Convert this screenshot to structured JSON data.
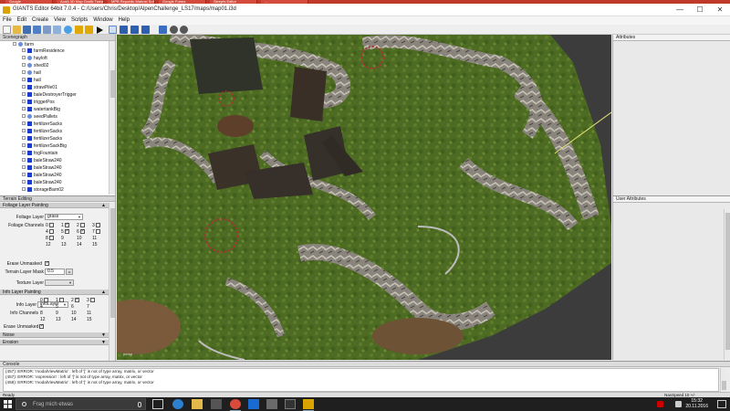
{
  "browser_tabs": [
    "Google",
    "AudA 3D Map Grafik Tweak",
    "MPB Republic Mahnei Sofa",
    "Google Forms",
    "Sleepfs Editor",
    "..."
  ],
  "window": {
    "title": "GIANTS Editor 64bit 7.0.4 - C:/Users/Chris/Desktop/AlpenChallenge_LS17/maps/map01.i3d",
    "minimize": "—",
    "maximize": "☐",
    "close": "✕"
  },
  "menu": [
    "File",
    "Edit",
    "Create",
    "View",
    "Scripts",
    "Window",
    "Help"
  ],
  "toolbar": {
    "icons": [
      "new-icon",
      "open-icon",
      "save-icon",
      "save-as-icon",
      "import-icon",
      "export-icon",
      "refresh-icon",
      "undo-icon",
      "redo-icon",
      "play-icon",
      "select-icon",
      "move-icon",
      "rotate-icon",
      "scale-icon",
      "terrain-icon",
      "settings-icon"
    ]
  },
  "scenegraph": {
    "title": "Scenegraph",
    "root": "farm",
    "items": [
      {
        "label": "farmResidence",
        "type": "mesh"
      },
      {
        "label": "hayloft",
        "type": "tg"
      },
      {
        "label": "shed02",
        "type": "tg"
      },
      {
        "label": "hall",
        "type": "tg"
      },
      {
        "label": "hall",
        "type": "mesh"
      },
      {
        "label": "strawPile01",
        "type": "mesh"
      },
      {
        "label": "baleDestroyerTrigger",
        "type": "mesh"
      },
      {
        "label": "triggerPos",
        "type": "mesh"
      },
      {
        "label": "watertankBig",
        "type": "mesh"
      },
      {
        "label": "seedPallets",
        "type": "tg"
      },
      {
        "label": "fertilizerSacks",
        "type": "mesh"
      },
      {
        "label": "fertilizerSacks",
        "type": "mesh"
      },
      {
        "label": "fertilizerSacks",
        "type": "mesh"
      },
      {
        "label": "fertilizerSackBig",
        "type": "mesh"
      },
      {
        "label": "fogFountain",
        "type": "mesh"
      },
      {
        "label": "baleStraw240",
        "type": "mesh"
      },
      {
        "label": "baleStraw240",
        "type": "mesh"
      },
      {
        "label": "baleStraw240",
        "type": "mesh"
      },
      {
        "label": "baleStraw240",
        "type": "mesh"
      },
      {
        "label": "storageBarn02",
        "type": "mesh"
      },
      {
        "label": "strawPile01",
        "type": "mesh"
      }
    ]
  },
  "terrain_editing": {
    "title": "Terrain Editing",
    "foliage_layer_painting": "Foliage Layer Painting",
    "foliage_layer_label": "Foliage Layer",
    "foliage_layer_value": "grass",
    "foliage_channels_label": "Foliage Channels",
    "foliage_channels": [
      {
        "n": "0",
        "checked": false
      },
      {
        "n": "1",
        "checked": true
      },
      {
        "n": "2",
        "checked": false
      },
      {
        "n": "3",
        "checked": false
      },
      {
        "n": "4",
        "checked": false
      },
      {
        "n": "5",
        "checked": true
      },
      {
        "n": "6",
        "checked": true
      },
      {
        "n": "7",
        "checked": false
      },
      {
        "n": "8",
        "checked": false
      },
      {
        "n": "9",
        "checked": null
      },
      {
        "n": "10",
        "checked": null
      },
      {
        "n": "11",
        "checked": null
      },
      {
        "n": "12",
        "checked": null
      },
      {
        "n": "13",
        "checked": null
      },
      {
        "n": "14",
        "checked": null
      },
      {
        "n": "15",
        "checked": null
      }
    ],
    "erase_unmasked_label": "Erase Unmasked",
    "terrain_layer_mask_label": "Terrain Layer Mask",
    "terrain_layer_mask_value": "0.5",
    "mask_button": "••",
    "texture_layer_label": "Texture Layer",
    "texture_layer_value": "",
    "info_layer_painting": "Info Layer Painting",
    "info_layer_label": "Info Layer",
    "info_layer_value": "infoLayer",
    "info_channels_label": "Info Channels",
    "info_channels": [
      {
        "n": "0",
        "checked": false
      },
      {
        "n": "1",
        "checked": false
      },
      {
        "n": "2",
        "checked": true
      },
      {
        "n": "3",
        "checked": false
      },
      {
        "n": "4",
        "checked": null
      },
      {
        "n": "5",
        "checked": null
      },
      {
        "n": "6",
        "checked": null
      },
      {
        "n": "7",
        "checked": null
      },
      {
        "n": "8",
        "checked": null
      },
      {
        "n": "9",
        "checked": null
      },
      {
        "n": "10",
        "checked": null
      },
      {
        "n": "11",
        "checked": null
      },
      {
        "n": "12",
        "checked": null
      },
      {
        "n": "13",
        "checked": null
      },
      {
        "n": "14",
        "checked": null
      },
      {
        "n": "15",
        "checked": null
      }
    ],
    "erase_unmasked_info_label": "Erase Unmasked",
    "noise": "Noise",
    "erosion": "Erosion"
  },
  "viewport": {
    "camera_label": "persp"
  },
  "attributes": {
    "title": "Attributes"
  },
  "user_attributes": {
    "title": "User Attributes"
  },
  "console": {
    "title": "Console",
    "lines": [
      "(457): ERROR: 'modalViewMatrix' : left of '[' is not of type array, matrix, or vector",
      "(457): ERROR: 'expression' : left of '[' is not of type array, matrix, or vector",
      "(458): ERROR: 'modalViewMatrix' : left of '[' is not of type array, matrix, or vector"
    ]
  },
  "status": {
    "left": "Ready",
    "right": "NavSpeed 10 +/-"
  },
  "taskbar": {
    "search_placeholder": "Frag mich etwas",
    "time": "15:32",
    "date": "20.11.2016",
    "language": "DEU",
    "colors": {
      "accent": "#d9a300",
      "error": "#c0392b",
      "taskbar": "#1f1f1f"
    }
  }
}
